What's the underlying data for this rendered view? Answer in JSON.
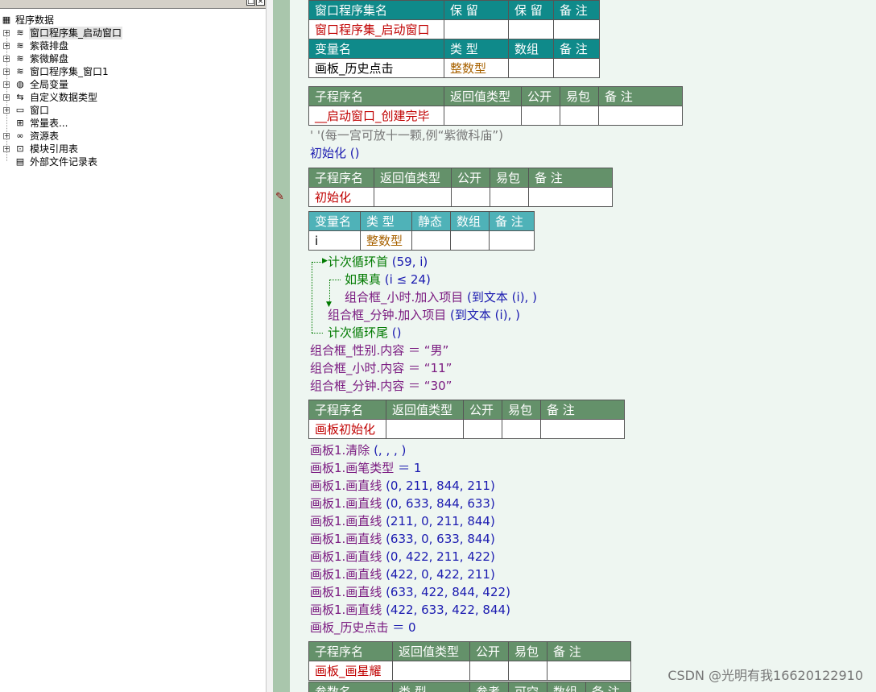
{
  "tree": {
    "root": "程序数据",
    "items": [
      {
        "label": "窗口程序集_启动窗口",
        "icon": "assembly-icon",
        "expander": "+",
        "selected": true
      },
      {
        "label": "紫薇排盘",
        "icon": "assembly-icon",
        "expander": "+"
      },
      {
        "label": "紫微解盘",
        "icon": "assembly-icon",
        "expander": "+"
      },
      {
        "label": "窗口程序集_窗口1",
        "icon": "assembly-icon",
        "expander": "+"
      },
      {
        "label": "全局变量",
        "icon": "global-var-icon",
        "expander": "+"
      },
      {
        "label": "自定义数据类型",
        "icon": "datatype-icon",
        "expander": "+"
      },
      {
        "label": "窗口",
        "icon": "window-icon",
        "expander": "+"
      },
      {
        "label": "常量表...",
        "icon": "constant-icon",
        "expander": ""
      },
      {
        "label": "资源表",
        "icon": "resource-icon",
        "expander": "+"
      },
      {
        "label": "模块引用表",
        "icon": "module-icon",
        "expander": "+"
      },
      {
        "label": "外部文件记录表",
        "icon": "file-icon",
        "expander": ""
      }
    ]
  },
  "asm_table": {
    "h1": [
      "窗口程序集名",
      "保 留",
      "保 留",
      "备 注"
    ],
    "v1": [
      "窗口程序集_启动窗口",
      "",
      "",
      ""
    ],
    "h2": [
      "变量名",
      "类 型",
      "数组",
      "备 注"
    ],
    "v2": [
      "画板_历史点击",
      "整数型",
      "",
      ""
    ]
  },
  "sub1": {
    "h": [
      "子程序名",
      "返回值类型",
      "公开",
      "易包",
      "备 注"
    ],
    "v": [
      "__启动窗口_创建完毕",
      "",
      "",
      "",
      ""
    ]
  },
  "comment": "' '(每一宫可放十一颗,例“紫微科庙”)",
  "init_call": "初始化 ()",
  "sub2": {
    "h": [
      "子程序名",
      "返回值类型",
      "公开",
      "易包",
      "备 注"
    ],
    "v": [
      "初始化",
      "",
      "",
      "",
      ""
    ]
  },
  "var2": {
    "h": [
      "变量名",
      "类 型",
      "静态",
      "数组",
      "备 注"
    ],
    "v": [
      "i",
      "整数型",
      "",
      "",
      ""
    ]
  },
  "loop": {
    "head": "计次循环首",
    "head_args": " (59, i)",
    "if_kw": "如果真",
    "if_args": " (i ≤ 24)",
    "add_hour": "组合框_小时.加入项目",
    "add_hour_args": " (到文本 (i), )",
    "add_min": "组合框_分钟.加入项目",
    "add_min_args": " (到文本 (i), )",
    "tail": "计次循环尾",
    "tail_args": " ()"
  },
  "assigns": [
    "组合框_性别.内容 ＝ “男”",
    "组合框_小时.内容 ＝ “11”",
    "组合框_分钟.内容 ＝ “30”"
  ],
  "sub3": {
    "h": [
      "子程序名",
      "返回值类型",
      "公开",
      "易包",
      "备 注"
    ],
    "v": [
      "画板初始化",
      "",
      "",
      "",
      ""
    ]
  },
  "board_lines": [
    "画板1.清除 (, , , )",
    "画板1.画笔类型 ＝ 1",
    "画板1.画直线 (0, 211, 844, 211)",
    "画板1.画直线 (0, 633, 844, 633)",
    "画板1.画直线 (211, 0, 211, 844)",
    "画板1.画直线 (633, 0, 633, 844)",
    "画板1.画直线 (0, 422, 211, 422)",
    "画板1.画直线 (422, 0, 422, 211)",
    "画板1.画直线 (633, 422, 844, 422)",
    "画板1.画直线 (422, 633, 422, 844)",
    "画板_历史点击 ＝ 0"
  ],
  "sub4": {
    "h": [
      "子程序名",
      "返回值类型",
      "公开",
      "易包",
      "备 注"
    ],
    "v": [
      "画板_画星耀",
      "",
      "",
      "",
      ""
    ]
  },
  "param_header": [
    "参数名",
    "类 型",
    "参考",
    "可空",
    "数组",
    "备 注"
  ],
  "watermark": "CSDN @光明有我16620122910"
}
